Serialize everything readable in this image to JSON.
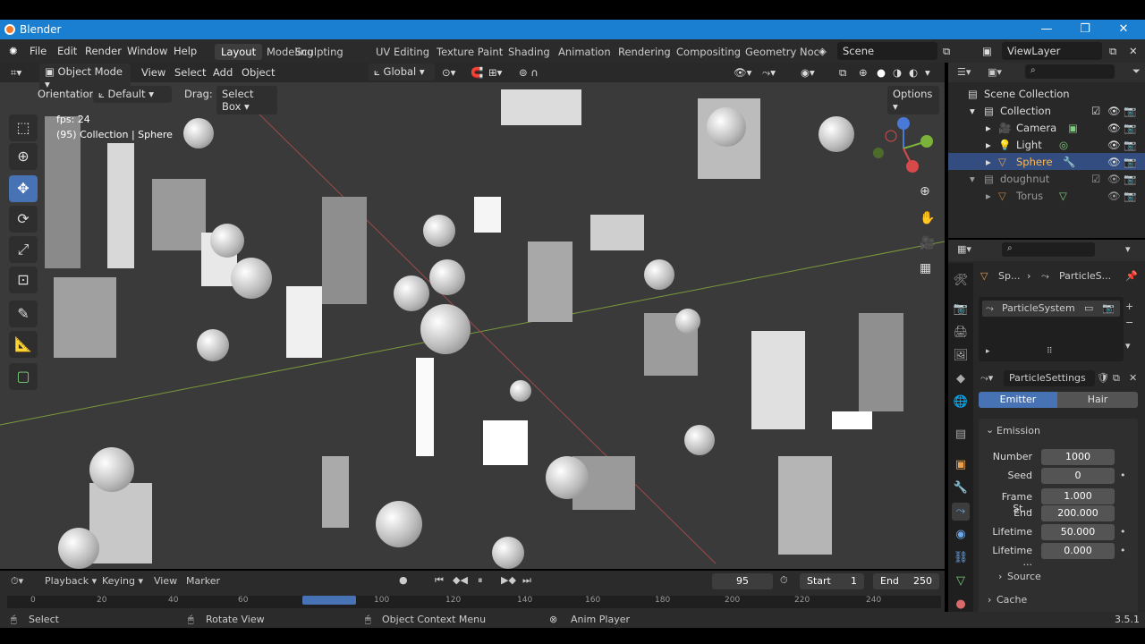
{
  "window": {
    "title": "Blender"
  },
  "menu": [
    "File",
    "Edit",
    "Render",
    "Window",
    "Help"
  ],
  "workspaces": [
    "Layout",
    "Modeling",
    "Sculpting",
    "UV Editing",
    "Texture Paint",
    "Shading",
    "Animation",
    "Rendering",
    "Compositing",
    "Geometry Noc"
  ],
  "scene": {
    "name": "Scene",
    "view_layer": "ViewLayer"
  },
  "viewport_header": {
    "mode": "Object Mode",
    "view": "View",
    "select": "Select",
    "add": "Add",
    "object": "Object",
    "transform": "Global",
    "options": "Options"
  },
  "tool_header": {
    "orientation_label": "Orientation:",
    "orientation_value": "Default",
    "drag_label": "Drag:",
    "drag_value": "Select Box"
  },
  "overlay": {
    "fps": "fps: 24",
    "info": "(95) Collection | Sphere"
  },
  "outliner": {
    "root": "Scene Collection",
    "items": [
      {
        "name": "Collection",
        "level": 1
      },
      {
        "name": "Camera",
        "level": 2
      },
      {
        "name": "Light",
        "level": 2
      },
      {
        "name": "Sphere",
        "level": 2,
        "selected": true
      },
      {
        "name": "doughnut",
        "level": 1
      },
      {
        "name": "Torus",
        "level": 2
      }
    ]
  },
  "properties": {
    "breadcrumb_a": "Sp...",
    "breadcrumb_b": "ParticleS...",
    "system_name": "ParticleSystem",
    "settings_name": "ParticleSettings",
    "type_emitter": "Emitter",
    "type_hair": "Hair",
    "emission_title": "Emission",
    "fields": [
      {
        "label": "Number",
        "value": "1000"
      },
      {
        "label": "Seed",
        "value": "0"
      },
      {
        "label": "Frame St...",
        "value": "1.000"
      },
      {
        "label": "End",
        "value": "200.000"
      },
      {
        "label": "Lifetime",
        "value": "50.000"
      },
      {
        "label": "Lifetime ...",
        "value": "0.000"
      }
    ],
    "source": "Source",
    "cache": "Cache"
  },
  "timeline": {
    "playback": "Playback",
    "keying": "Keying",
    "view": "View",
    "marker": "Marker",
    "current_frame": "95",
    "start_label": "Start",
    "start_value": "1",
    "end_label": "End",
    "end_value": "250",
    "ruler": [
      "0",
      "20",
      "40",
      "60",
      "100",
      "120",
      "140",
      "160",
      "180",
      "200",
      "220",
      "240"
    ]
  },
  "status": {
    "select": "Select",
    "rotate": "Rotate View",
    "context": "Object Context Menu",
    "anim": "Anim Player",
    "version": "3.5.1"
  },
  "colors": {
    "accent": "#4772b3",
    "titlebar": "#1a7fd0",
    "selected_row": "#334d80"
  }
}
